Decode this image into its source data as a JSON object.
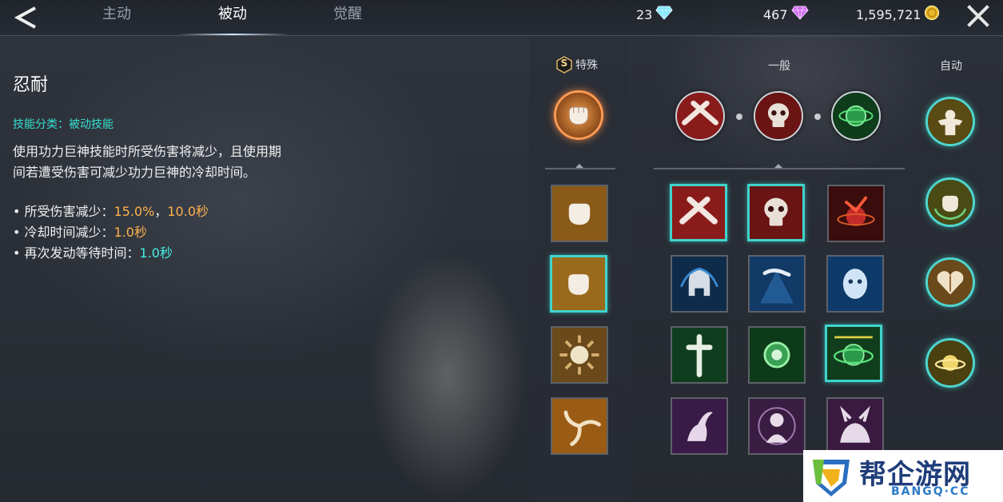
{
  "tabs": [
    {
      "label": "主动"
    },
    {
      "label": "被动"
    },
    {
      "label": "觉醒"
    }
  ],
  "currencies": {
    "diamond_blue": "23",
    "diamond_purple": "467",
    "gold": "1,595,721"
  },
  "skill": {
    "name": "忍耐",
    "category": "技能分类：被动技能",
    "description": "使用功力巨神技能时所受伤害将减少，且使用期间若遭受伤害可减少功力巨神的冷却时间。",
    "bullets": [
      {
        "prefix": "• 所受伤害减少：",
        "value1": "15.0%",
        "sep": "，",
        "value2": "10.0秒"
      },
      {
        "prefix": "• 冷却时间减少：",
        "value1": "1.0秒"
      },
      {
        "prefix": "• 再次发动等待时间：",
        "value1": "1.0秒"
      }
    ]
  },
  "columns": {
    "special_badge": "S",
    "special": "特殊",
    "general": "一般",
    "auto": "自动"
  },
  "icons": {
    "special_selected": "fist-icon",
    "general_selected": [
      "crossed-arms-icon",
      "skull-icon",
      "green-orb-icon"
    ],
    "special_grid": [
      "fist-icon",
      "fist-icon",
      "sun-emblem-icon",
      "triskelion-icon"
    ],
    "general_grid": [
      [
        "crossed-arms-icon",
        "skull-icon",
        "red-burst-icon"
      ],
      [
        "spartan-helmet-icon",
        "hand-beam-icon",
        "spirit-face-icon"
      ],
      [
        "holy-cross-icon",
        "green-orb-icon",
        "green-orb-ring-icon"
      ],
      [
        "winged-figure-icon",
        "meditating-figure-icon",
        "beast-icon"
      ]
    ],
    "auto": [
      "muscle-figure-icon",
      "fist-wreath-icon",
      "heart-shield-icon",
      "gold-planet-icon"
    ]
  },
  "watermark": {
    "title": "帮企游网",
    "subtitle": "BANGQ·CC"
  }
}
